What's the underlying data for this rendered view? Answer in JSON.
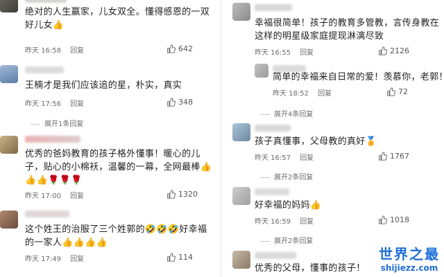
{
  "left_comments": [
    {
      "lines": [
        "绝对的人生赢家，儿女双全。懂得感恩的一双",
        "好儿女👍"
      ],
      "time": "昨天 16:58",
      "reply": "回复",
      "likes": "642"
    },
    {
      "lines": [
        "王楠才是我们应该追的星，朴实，真实"
      ],
      "time": "昨天 17:56",
      "reply": "回复",
      "likes": "348",
      "expand": "展开1条回复"
    },
    {
      "lines": [
        "优秀的爸妈教育的孩子格外懂事！暖心的儿",
        "子，贴心的小棉袄，温馨的一幕，全网最棒👍",
        "👍👍🌹🌹🌹"
      ],
      "time": "昨天 17:00",
      "reply": "回复",
      "likes": "1320"
    },
    {
      "lines": [
        "这个姓王的治服了三个姓郭的🤣🤣🤣好幸福",
        "的一家人👍👍👍👍"
      ],
      "time": "昨天 17:49",
      "reply": "回复",
      "likes": "114"
    }
  ],
  "right_comments": [
    {
      "lines": [
        "幸福很简单！孩子的教育多管教，言传身教在",
        "这样的明星级家庭提现淋漓尽致"
      ],
      "time": "昨天 16:55",
      "reply": "回复",
      "likes": "2126"
    },
    {
      "lines": [
        "简单的幸福来自日常的爱！羡慕你，老郭！"
      ],
      "time": "昨天 18:52",
      "reply": "回复",
      "likes": "72",
      "expand": "展开4条回复"
    },
    {
      "lines": [
        "孩子真懂事，父母教的真好🏅"
      ],
      "time": "昨天 16:57",
      "reply": "回复",
      "likes": "1767",
      "expand": "展开2条回复"
    },
    {
      "lines": [
        "好幸福的妈妈👍"
      ],
      "time": "昨天 16:59",
      "reply": "回复",
      "likes": "1018",
      "expand": "展开2条回复"
    },
    {
      "lines": [
        "优秀的父母，懂事的孩子！"
      ]
    }
  ],
  "watermark": {
    "title": "世界之最",
    "url": "shijiezz.com"
  },
  "colors": {
    "text": "#222222",
    "meta": "#6b6b6b",
    "watermark": "#1e6fd9"
  }
}
